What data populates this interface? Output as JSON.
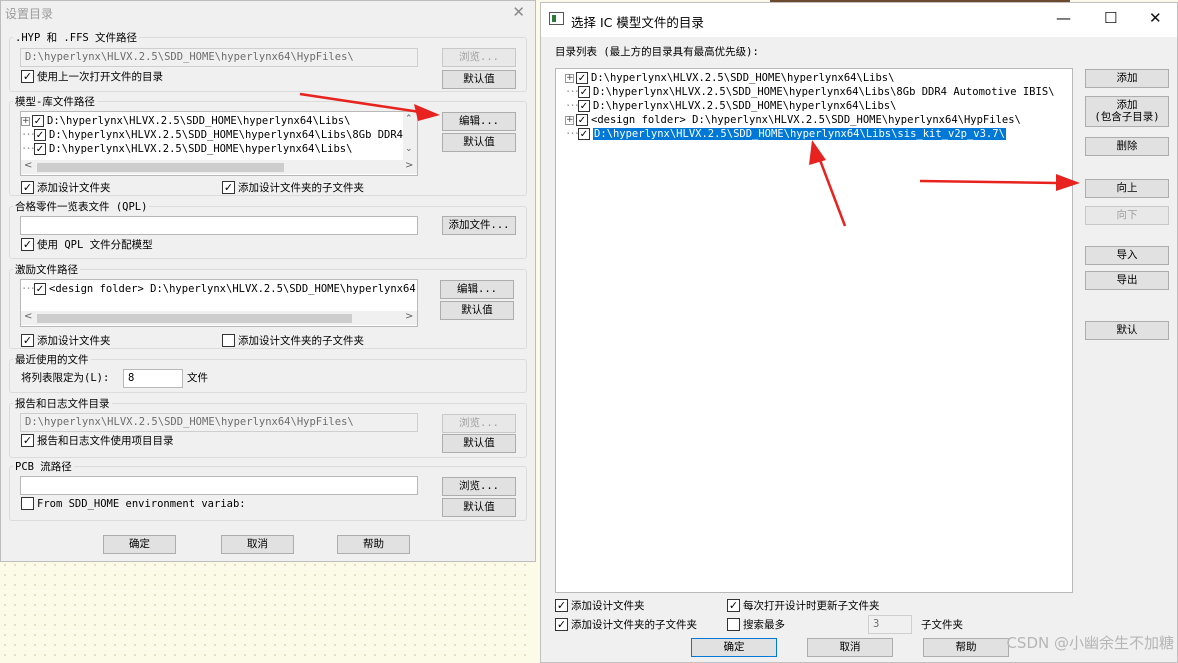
{
  "left": {
    "title": "设置目录",
    "close": "✕",
    "hyp": {
      "label": ".HYP 和 .FFS 文件路径",
      "value": "D:\\hyperlynx\\HLVX.2.5\\SDD_HOME\\hyperlynx64\\HypFiles\\",
      "browse": "浏览...",
      "use_last": "使用上一次打开文件的目录",
      "default": "默认值"
    },
    "model": {
      "label": "模型-库文件路径",
      "rows": [
        "D:\\hyperlynx\\HLVX.2.5\\SDD_HOME\\hyperlynx64\\Libs\\",
        "D:\\hyperlynx\\HLVX.2.5\\SDD_HOME\\hyperlynx64\\Libs\\8Gb DDR4",
        "D:\\hyperlynx\\HLVX.2.5\\SDD_HOME\\hyperlynx64\\Libs\\"
      ],
      "edit": "编辑...",
      "default": "默认值",
      "add_design": "添加设计文件夹",
      "add_sub": "添加设计文件夹的子文件夹"
    },
    "qpl": {
      "label": "合格零件一览表文件 (QPL)",
      "value": "",
      "add_file": "添加文件...",
      "use_qpl": "使用 QPL 文件分配模型"
    },
    "stim": {
      "label": "激励文件路径",
      "row": "<design folder>  D:\\hyperlynx\\HLVX.2.5\\SDD_HOME\\hyperlynx64'",
      "edit": "编辑...",
      "default": "默认值",
      "add_design": "添加设计文件夹",
      "add_sub": "添加设计文件夹的子文件夹"
    },
    "recent": {
      "label": "最近使用的文件",
      "limit_label": "将列表限定为(L):",
      "limit_value": "8",
      "unit": "文件"
    },
    "report": {
      "label": "报告和日志文件目录",
      "value": "D:\\hyperlynx\\HLVX.2.5\\SDD_HOME\\hyperlynx64\\HypFiles\\",
      "browse": "浏览...",
      "use_project": "报告和日志文件使用项目目录",
      "default": "默认值"
    },
    "pcb": {
      "label": "PCB 流路径",
      "value": "",
      "browse": "浏览...",
      "from_env": "From SDD_HOME environment variab:",
      "default": "默认值"
    },
    "ok": "确定",
    "cancel": "取消",
    "help": "帮助"
  },
  "right": {
    "title": "选择 IC 模型文件的目录",
    "minimize": "—",
    "maximize": "☐",
    "close": "✕",
    "list_label": "目录列表 (最上方的目录具有最高优先级):",
    "rows": [
      "D:\\hyperlynx\\HLVX.2.5\\SDD_HOME\\hyperlynx64\\Libs\\",
      "D:\\hyperlynx\\HLVX.2.5\\SDD_HOME\\hyperlynx64\\Libs\\8Gb DDR4 Automotive IBIS\\",
      "D:\\hyperlynx\\HLVX.2.5\\SDD_HOME\\hyperlynx64\\Libs\\",
      "<design folder>  D:\\hyperlynx\\HLVX.2.5\\SDD_HOME\\hyperlynx64\\HypFiles\\",
      "D:\\hyperlynx\\HLVX.2.5\\SDD_HOME\\hyperlynx64\\Libs\\sis_kit_v2p_v3.7\\"
    ],
    "buttons": {
      "add": "添加",
      "add_sub_1": "添加",
      "add_sub_2": "(包含子目录)",
      "delete": "删除",
      "up": "向上",
      "down": "向下",
      "import": "导入",
      "export": "导出",
      "default": "默认"
    },
    "add_design": "添加设计文件夹",
    "add_sub": "添加设计文件夹的子文件夹",
    "refresh_sub": "每次打开设计时更新子文件夹",
    "search_max": "搜索最多",
    "search_value": "3",
    "subfolders": "子文件夹",
    "ok": "确定",
    "cancel": "取消",
    "help": "帮助"
  },
  "watermark": "CSDN @小幽余生不加糖"
}
